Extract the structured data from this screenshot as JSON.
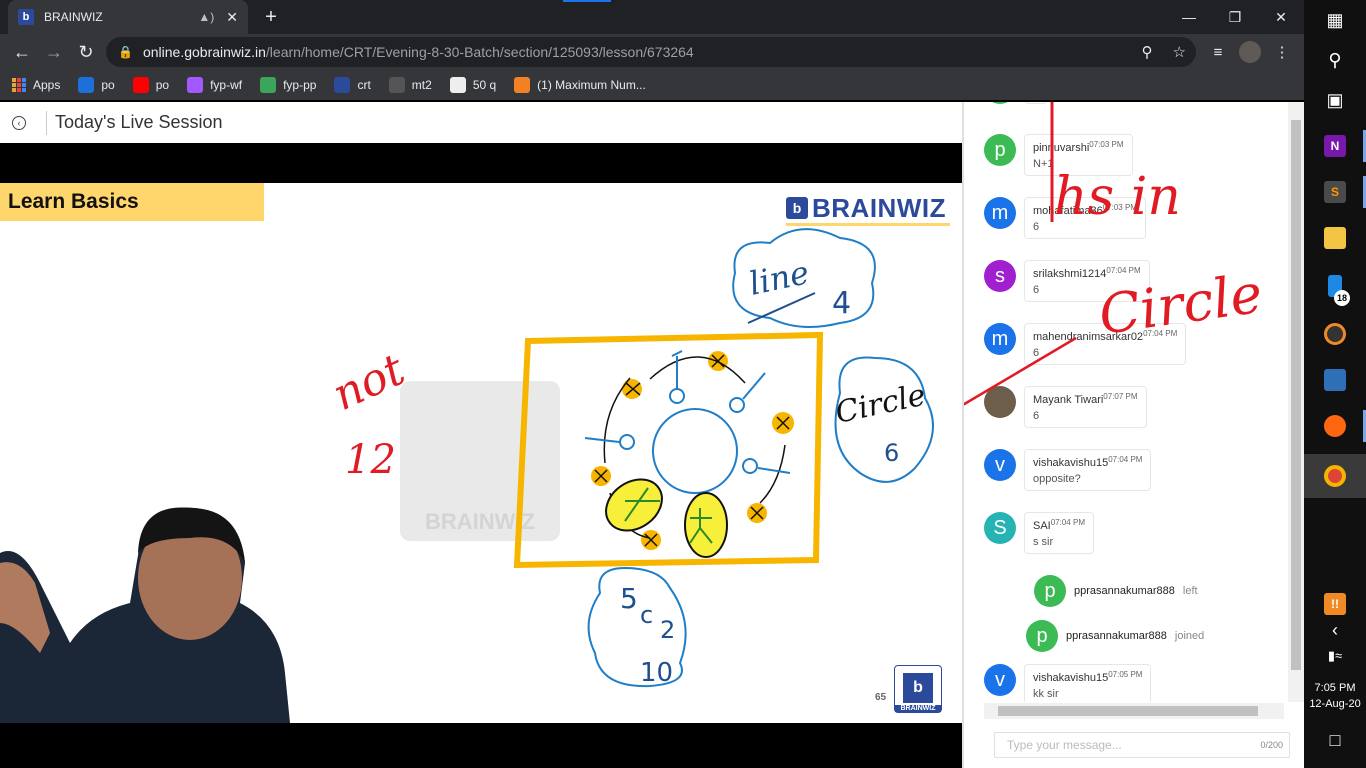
{
  "browser": {
    "tab_title": "BRAINWIZ",
    "tab_favicon": "b",
    "url_host": "online.gobrainwiz.in",
    "url_path": "/learn/home/CRT/Evening-8-30-Batch/section/125093/lesson/673264"
  },
  "bookmarks": [
    {
      "label": "Apps",
      "icon": "apps-grid-icon"
    },
    {
      "label": "po",
      "icon": "ie-icon",
      "color": "#1e6fd9"
    },
    {
      "label": "po",
      "icon": "youtube-icon",
      "color": "#ff0000"
    },
    {
      "label": "fyp-wf",
      "icon": "figma-icon",
      "color": "#a259ff"
    },
    {
      "label": "fyp-pp",
      "icon": "chart-icon",
      "color": "#3ba55c"
    },
    {
      "label": "crt",
      "icon": "brainwiz-icon",
      "color": "#2b4a9b"
    },
    {
      "label": "mt2",
      "icon": "cc-icon",
      "color": "#555555"
    },
    {
      "label": "50 q",
      "icon": "globe-icon",
      "color": "#eeeeee"
    },
    {
      "label": "(1) Maximum Num...",
      "icon": "stackoverflow-icon",
      "color": "#f48024"
    }
  ],
  "page": {
    "title": "Today's Live Session"
  },
  "slide": {
    "heading": "Learn Basics",
    "brand": "BRAINWIZ",
    "brand_mark": "b",
    "page_number": "65",
    "watermark": "BRAINWIZ",
    "corner_logo_text": "BRAINWIZ",
    "annotations": {
      "line_label": "line",
      "line_value": "4",
      "circle_label": "Circle",
      "circle_value": "6",
      "comb_top": "5",
      "comb_c": "c",
      "comb_k": "2",
      "comb_value": "10",
      "not_label": "not",
      "not_value": "12"
    },
    "chat_overlay": {
      "word1": "hs in",
      "word2": "Circle"
    }
  },
  "chat": {
    "messages": [
      {
        "user": "",
        "time": "",
        "text": "6",
        "avatar_letter": "",
        "avatar_color": "#3cba54"
      },
      {
        "user": "pinnuvarshi",
        "time": "07:03 PM",
        "text": "N+1",
        "avatar_letter": "p",
        "avatar_color": "#3cba54"
      },
      {
        "user": "mohafatima36",
        "time": "07:03 PM",
        "text": "6",
        "avatar_letter": "m",
        "avatar_color": "#1a73e8"
      },
      {
        "user": "srilakshmi1214",
        "time": "07:04 PM",
        "text": "6",
        "avatar_letter": "s",
        "avatar_color": "#a020d0"
      },
      {
        "user": "mahendranimsarkar02",
        "time": "07:04 PM",
        "text": "6",
        "avatar_letter": "m",
        "avatar_color": "#1a73e8"
      },
      {
        "user": "Mayank Tiwari",
        "time": "07:07 PM",
        "text": "6",
        "avatar_letter": "",
        "avatar_color": "#6d5d4b"
      },
      {
        "user": "vishakavishu15",
        "time": "07:04 PM",
        "text": "opposite?",
        "avatar_letter": "v",
        "avatar_color": "#1a73e8"
      },
      {
        "user": "SAI",
        "time": "07:04 PM",
        "text": "s sir",
        "avatar_letter": "S",
        "avatar_color": "#26b3b3"
      },
      {
        "user": "vishakavishu15",
        "time": "07:05 PM",
        "text": "kk sir",
        "avatar_letter": "v",
        "avatar_color": "#1a73e8"
      }
    ],
    "system": [
      {
        "user": "pprasannakumar888",
        "action": "left",
        "avatar_letter": "p",
        "avatar_color": "#3cba54"
      },
      {
        "user": "pprasannakumar888",
        "action": "joined",
        "avatar_letter": "p",
        "avatar_color": "#3cba54"
      }
    ],
    "input_placeholder": "Type your message...",
    "counter": "0/200"
  },
  "taskbar": {
    "time": "7:05 PM",
    "date": "12-Aug-20",
    "notification_count": "18"
  }
}
